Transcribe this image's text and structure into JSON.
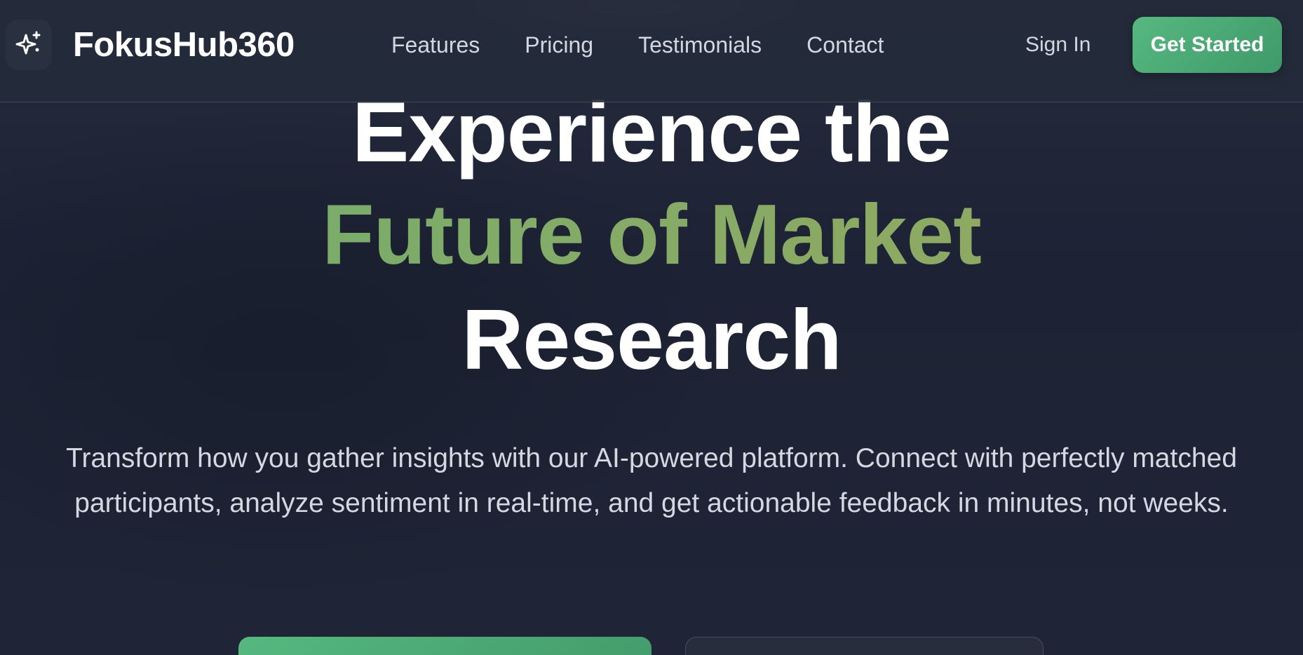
{
  "colors": {
    "accent": "#4fae78",
    "background": "#1e2435",
    "headline_gradient": [
      "#6fae6c",
      "#96a85e"
    ]
  },
  "header": {
    "logo_icon": "sparkles-icon",
    "brand": "FokusHub360",
    "nav": [
      {
        "label": "Features"
      },
      {
        "label": "Pricing"
      },
      {
        "label": "Testimonials"
      },
      {
        "label": "Contact"
      }
    ],
    "sign_in": "Sign In",
    "get_started": "Get Started"
  },
  "hero": {
    "line1": "Experience the",
    "line2": "Future of Market",
    "line3": "Research",
    "subtitle": "Transform how you gather insights with our AI-powered platform. Connect with perfectly matched participants, analyze sentiment in real-time, and get actionable feedback in minutes, not weeks."
  }
}
